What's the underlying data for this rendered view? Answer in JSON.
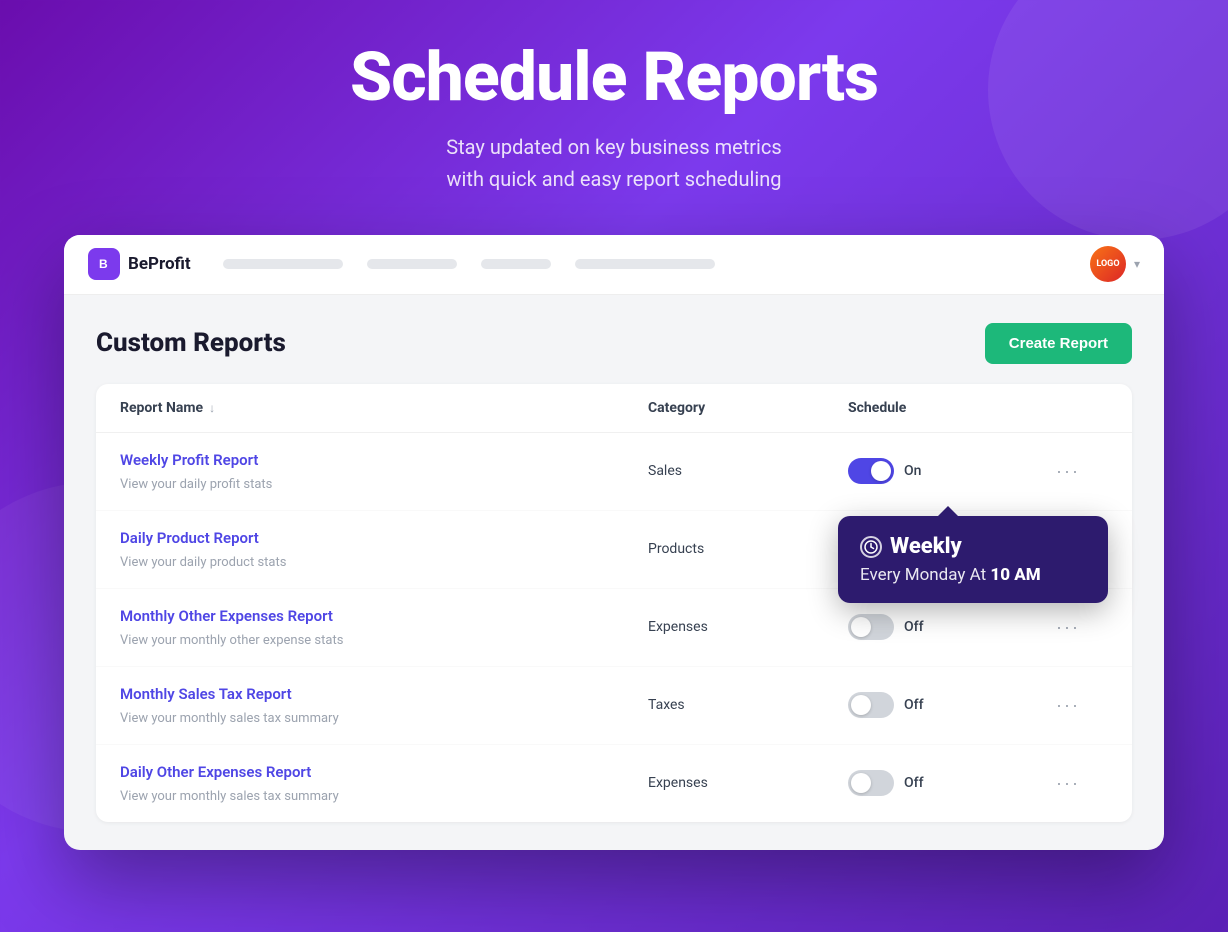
{
  "hero": {
    "title": "Schedule Reports",
    "subtitle_line1": "Stay updated on key business metrics",
    "subtitle_line2": "with quick and easy report scheduling"
  },
  "navbar": {
    "logo_text": "BeProfit",
    "logo_icon_label": "B",
    "avatar_label": "LOGO",
    "nav_placeholders": [
      120,
      90,
      70,
      140
    ]
  },
  "page": {
    "title": "Custom Reports",
    "create_button": "Create Report"
  },
  "table": {
    "columns": {
      "report_name": "Report Name",
      "category": "Category",
      "schedule": "Schedule"
    },
    "rows": [
      {
        "id": "row-1",
        "name": "Weekly Profit Report",
        "description": "View your daily profit stats",
        "category": "Sales",
        "schedule_on": true,
        "schedule_label_on": "On",
        "schedule_label_off": "Off",
        "has_tooltip": true,
        "tooltip": {
          "frequency": "Weekly",
          "schedule_text": "Every Monday At",
          "time": "10 AM"
        }
      },
      {
        "id": "row-2",
        "name": "Daily Product Report",
        "description": "View your daily product stats",
        "category": "Products",
        "schedule_on": false,
        "schedule_label_on": "On",
        "schedule_label_off": "Off",
        "has_tooltip": false
      },
      {
        "id": "row-3",
        "name": "Monthly Other Expenses Report",
        "description": "View your monthly other expense stats",
        "category": "Expenses",
        "schedule_on": false,
        "schedule_label_on": "On",
        "schedule_label_off": "Off",
        "has_tooltip": false
      },
      {
        "id": "row-4",
        "name": "Monthly Sales Tax Report",
        "description": "View your monthly sales tax summary",
        "category": "Taxes",
        "schedule_on": false,
        "schedule_label_on": "On",
        "schedule_label_off": "Off",
        "has_tooltip": false
      },
      {
        "id": "row-5",
        "name": "Daily Other Expenses Report",
        "description": "View your monthly sales tax summary",
        "category": "Expenses",
        "schedule_on": false,
        "schedule_label_on": "On",
        "schedule_label_off": "Off",
        "has_tooltip": false
      }
    ]
  },
  "colors": {
    "brand_purple": "#7c3aed",
    "link_blue": "#4f46e5",
    "toggle_on": "#4f46e5",
    "toggle_off": "#d1d5db",
    "create_btn": "#1db87a",
    "tooltip_bg": "#2d1b6e"
  }
}
